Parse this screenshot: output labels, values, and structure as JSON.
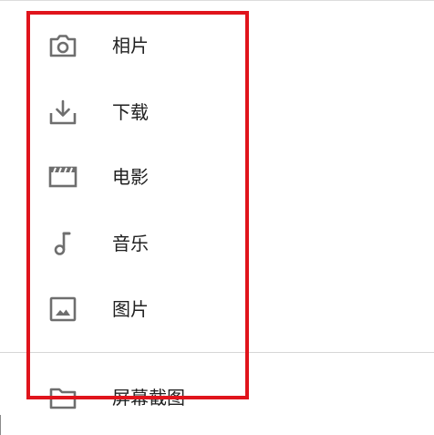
{
  "drawer": {
    "items": [
      {
        "label": "相片",
        "icon": "camera-icon"
      },
      {
        "label": "下载",
        "icon": "download-icon"
      },
      {
        "label": "电影",
        "icon": "movie-icon"
      },
      {
        "label": "音乐",
        "icon": "music-note-icon"
      },
      {
        "label": "图片",
        "icon": "image-icon"
      }
    ],
    "secondary_items": [
      {
        "label": "屏幕截图",
        "icon": "folder-icon"
      }
    ]
  },
  "colors": {
    "icon": "#6e6e6e",
    "text": "#212121",
    "highlight": "#e0141c",
    "divider": "#d6d6d6"
  }
}
